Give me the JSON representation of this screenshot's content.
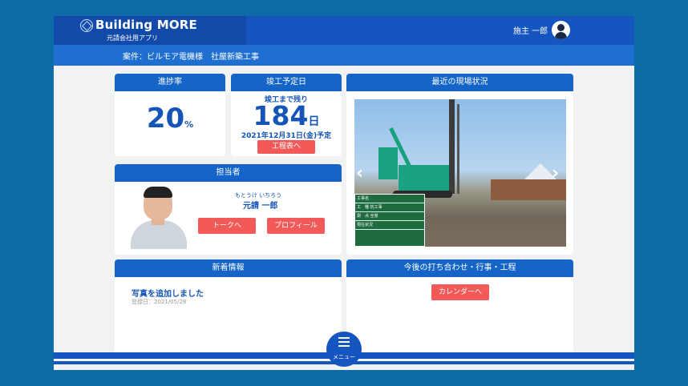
{
  "header": {
    "brand": "Building MORE",
    "subtitle": "元請会社用アプリ",
    "user_name": "施主 一郎"
  },
  "project": {
    "label": "案件：ビルモア電機様　社屋新築工事"
  },
  "progress": {
    "title": "進捗率",
    "value": "20",
    "unit": "%"
  },
  "deadline": {
    "title": "竣工予定日",
    "label": "竣工まで残り",
    "days": "184",
    "unit": "日",
    "date": "2021年12月31日(金)予定",
    "button": "工程表へ"
  },
  "site": {
    "title": "最近の現場状況",
    "board": [
      "工事名",
      "工　種 杭工事",
      "測　点 全景",
      "現在状況"
    ]
  },
  "staff": {
    "title": "担当者",
    "kana": "もとうけ いちろう",
    "name": "元請 一郎",
    "talk_button": "トークへ",
    "profile_button": "プロフィール"
  },
  "news": {
    "title": "新着情報",
    "item_title": "写真を追加しました",
    "item_date": "登録日：2021/05/28"
  },
  "schedule": {
    "title": "今後の打ち合わせ・行事・工程",
    "button": "カレンダーへ"
  },
  "menu": {
    "label": "メニュー"
  }
}
